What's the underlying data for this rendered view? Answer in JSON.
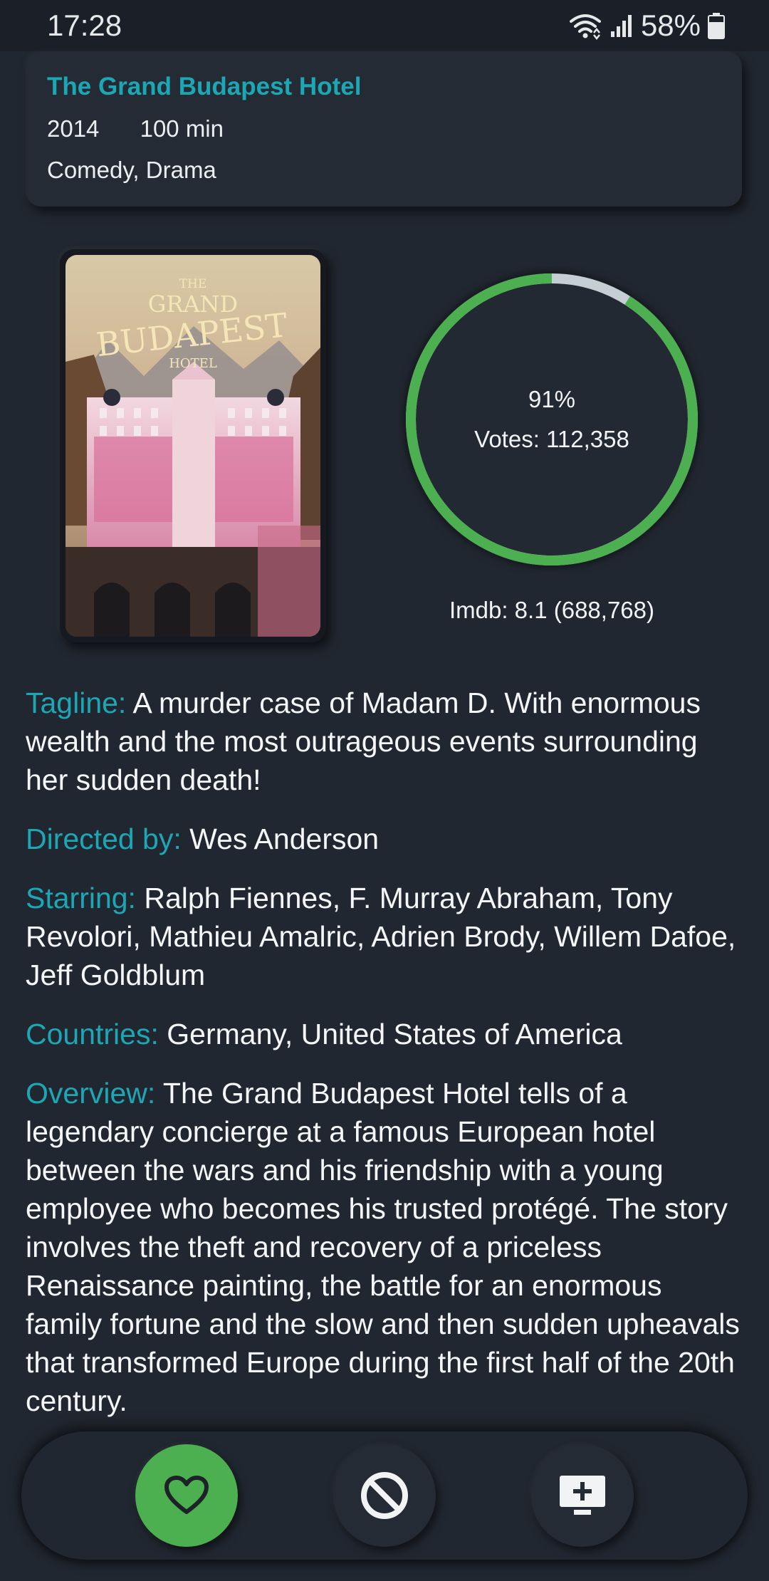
{
  "status_bar": {
    "time": "17:28",
    "battery": "58%",
    "icons": [
      "wifi-icon",
      "signal-icon",
      "battery-icon"
    ]
  },
  "movie": {
    "title": "The Grand Budapest Hotel",
    "year": "2014",
    "runtime": "100 min",
    "genres": "Comedy, Drama"
  },
  "poster": {
    "title_small": "THE",
    "title_main_1": "GRAND",
    "title_main_2": "BUDAPEST",
    "title_sub": "HOTEL"
  },
  "rating": {
    "percent": 91,
    "percent_text": "91%",
    "votes_text": "Votes: 112,358",
    "imdb_text": "Imdb: 8.1 (688,768)"
  },
  "details": {
    "tagline_label": "Tagline:",
    "tagline": "A murder case of Madam D. With enormous wealth and the most outrageous events surrounding her sudden death!",
    "director_label": "Directed by:",
    "director": "Wes Anderson",
    "starring_label": "Starring:",
    "starring": "Ralph Fiennes, F. Murray Abraham, Tony Revolori, Mathieu Amalric, Adrien Brody, Willem Dafoe, Jeff Goldblum",
    "countries_label": "Countries:",
    "countries": "Germany, United States of America",
    "overview_label": "Overview:",
    "overview": "The Grand Budapest Hotel tells of a legendary concierge at a famous European hotel between the wars and his friendship with a young employee who becomes his trusted protégé. The story involves the theft and recovery of a priceless Renaissance painting, the battle for an enormous family fortune and the slow and then sudden upheavals that transformed Europe during the first half of the 20th century."
  },
  "actions": {
    "favorite_icon": "heart-icon",
    "block_icon": "block-icon",
    "watchlist_icon": "add-to-watchlist-icon"
  },
  "colors": {
    "background": "#212730",
    "accent": "#1ba8b4",
    "ring_fill": "#4caf50",
    "ring_track": "#c5cfd3",
    "favorite_button": "#4caf50"
  }
}
